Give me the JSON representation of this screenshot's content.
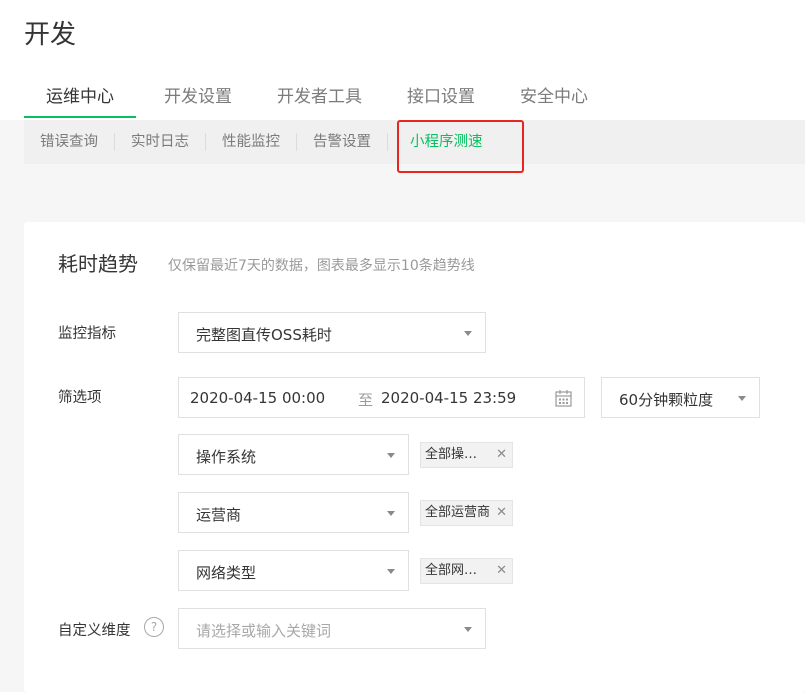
{
  "header": {
    "title": "开发"
  },
  "main_tabs": [
    {
      "label": "运维中心",
      "active": true
    },
    {
      "label": "开发设置",
      "active": false
    },
    {
      "label": "开发者工具",
      "active": false
    },
    {
      "label": "接口设置",
      "active": false
    },
    {
      "label": "安全中心",
      "active": false
    }
  ],
  "sub_tabs": [
    {
      "label": "错误查询",
      "active": false
    },
    {
      "label": "实时日志",
      "active": false
    },
    {
      "label": "性能监控",
      "active": false
    },
    {
      "label": "告警设置",
      "active": false
    },
    {
      "label": "小程序测速",
      "active": true
    }
  ],
  "card": {
    "title": "耗时趋势",
    "note": "仅保留最近7天的数据，图表最多显示10条趋势线",
    "metric": {
      "label": "监控指标",
      "value": "完整图直传OSS耗时"
    },
    "filter": {
      "label": "筛选项",
      "date_start": "2020-04-15 00:00",
      "date_sep": "至",
      "date_end": "2020-04-15 23:59",
      "granularity": "60分钟颗粒度",
      "rows": [
        {
          "select": "操作系统",
          "tag": "全部操…"
        },
        {
          "select": "运营商",
          "tag": "全部运营商"
        },
        {
          "select": "网络类型",
          "tag": "全部网…"
        }
      ]
    },
    "custom": {
      "label": "自定义维度",
      "help_icon": "?",
      "placeholder": "请选择或输入关键词"
    }
  },
  "colors": {
    "accent": "#07c160",
    "highlight": "#e8261f"
  }
}
